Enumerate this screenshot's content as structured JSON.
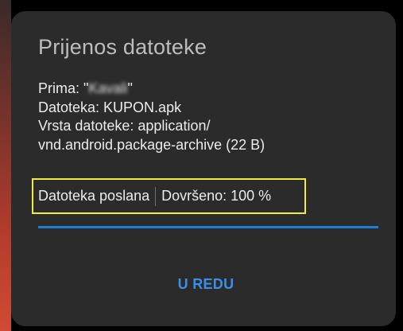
{
  "dialog": {
    "title": "Prijenos datoteke",
    "recipient_label": "Prima: ",
    "recipient_name": "Kavali",
    "file_line": "Datoteka: KUPON.apk",
    "type_line_1": "Vrsta datoteke: application/",
    "type_line_2": "vnd.android.package-archive (22 B)",
    "status": "Datoteka poslana",
    "completion": "Dovršeno: 100 %",
    "progress_fraction": 1.0,
    "ok_button": "U REDU"
  },
  "colors": {
    "dialog_background": "#2b2b2b",
    "accent_blue": "#1b7fd8",
    "highlight_box": "#f2ea3c"
  }
}
